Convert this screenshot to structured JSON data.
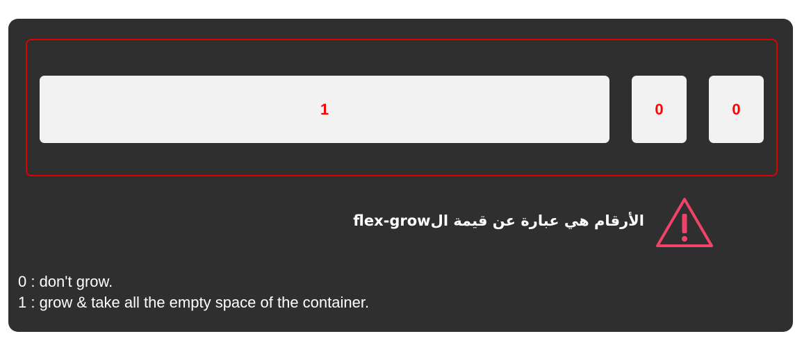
{
  "flex_demo": {
    "items": [
      {
        "label": "1"
      },
      {
        "label": "0"
      },
      {
        "label": "0"
      }
    ]
  },
  "note": {
    "arabic": "الأرقام هي عبارة عن قيمة ال",
    "property": "flex-grow",
    "icon": "warning-triangle-icon",
    "icon_color": "#f0436a"
  },
  "legend": {
    "line_0": "0 : don't grow.",
    "line_1": "1 : grow & take all the empty space of the container."
  },
  "colors": {
    "card_background": "#2f2f2f",
    "container_border": "#e00000",
    "item_background": "#f2f2f2",
    "item_text": "#ff0000"
  }
}
